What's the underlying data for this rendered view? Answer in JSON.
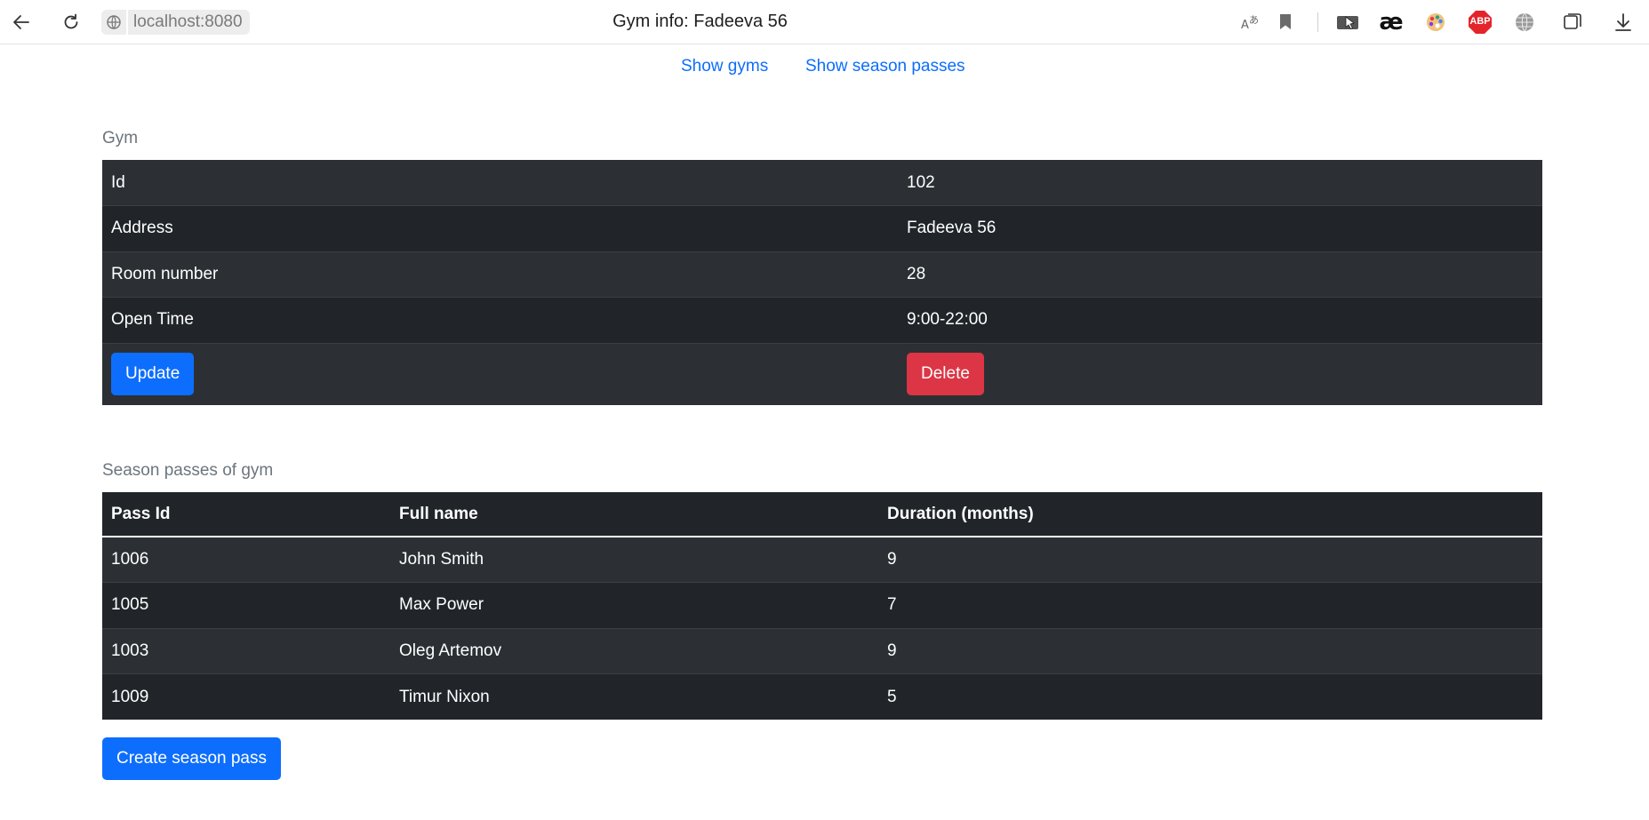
{
  "browser": {
    "url": "localhost:8080",
    "tab_title": "Gym info: Fadeeva 56",
    "extensions": [
      "translate-icon",
      "bookmark-icon",
      "cursor-extension-icon",
      "ae-extension-icon",
      "palette-extension-icon",
      "adblock-plus-icon",
      "globe-extension-icon",
      "collections-icon",
      "download-icon"
    ],
    "adblock_label": "ABP",
    "ae_label": "æ"
  },
  "nav": {
    "show_gyms": "Show gyms",
    "show_passes": "Show season passes"
  },
  "gym": {
    "section_label": "Gym",
    "rows": [
      {
        "label": "Id",
        "value": "102"
      },
      {
        "label": "Address",
        "value": "Fadeeva 56"
      },
      {
        "label": "Room number",
        "value": "28"
      },
      {
        "label": "Open Time",
        "value": "9:00-22:00"
      }
    ],
    "update_label": "Update",
    "delete_label": "Delete"
  },
  "passes": {
    "section_label": "Season passes of gym",
    "headers": [
      "Pass Id",
      "Full name",
      "Duration (months)"
    ],
    "rows": [
      {
        "id": "1006",
        "name": "John Smith",
        "duration": "9"
      },
      {
        "id": "1005",
        "name": "Max Power",
        "duration": "7"
      },
      {
        "id": "1003",
        "name": "Oleg Artemov",
        "duration": "9"
      },
      {
        "id": "1009",
        "name": "Timur Nixon",
        "duration": "5"
      }
    ],
    "create_label": "Create season pass"
  },
  "colors": {
    "primary": "#0d6efd",
    "danger": "#dc3545",
    "table_dark": "#212529",
    "table_striped": "#2c3034"
  }
}
